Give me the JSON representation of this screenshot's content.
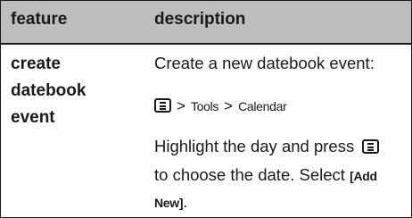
{
  "header": {
    "feature_label": "feature",
    "description_label": "description"
  },
  "row": {
    "feature": [
      "create",
      "datebook",
      "event"
    ],
    "intro": "Create a new datebook event:",
    "path": {
      "gt1": ">",
      "item1": "Tools",
      "gt2": ">",
      "item2": "Calendar"
    },
    "line3": "Highlight the day and press",
    "line4": "to choose the date. Select",
    "bracket_open": "[",
    "add": "Add",
    "new": "New",
    "bracket_close": "]",
    "period": "."
  },
  "icons": [
    "menu-key-icon"
  ],
  "colors": {
    "header_bg": "#bdbdbd",
    "border": "#1a1a1a"
  }
}
